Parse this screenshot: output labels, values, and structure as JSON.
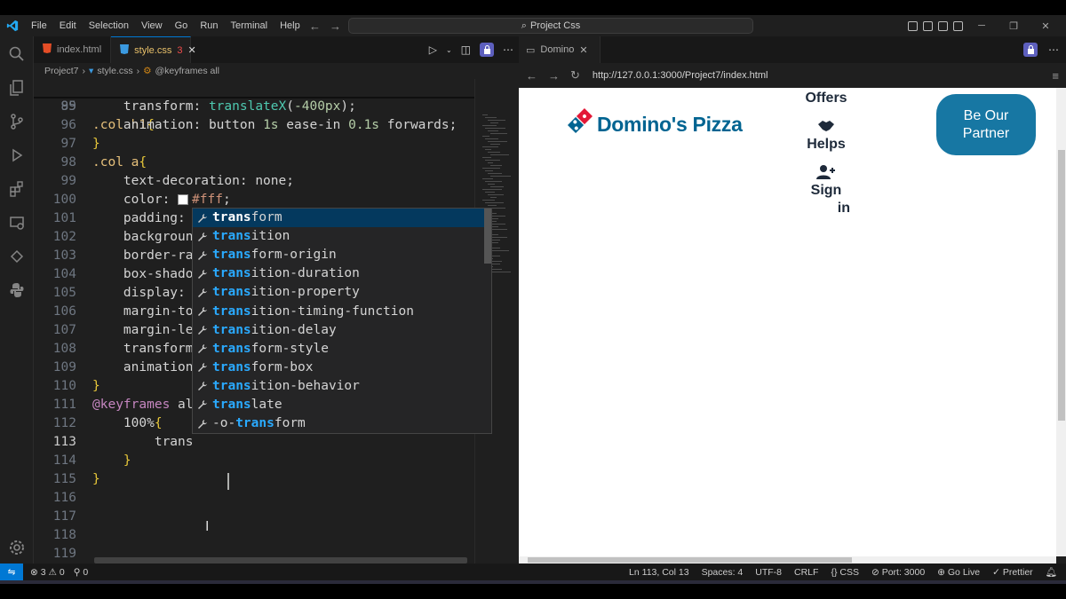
{
  "titlebar": {
    "menu": [
      "File",
      "Edit",
      "Selection",
      "View",
      "Go",
      "Run",
      "Terminal",
      "Help"
    ],
    "command_center": "Project Css"
  },
  "tabs": [
    {
      "label": "index.html",
      "icon": "html5-icon"
    },
    {
      "label": "style.css",
      "problems": "3",
      "icon": "css-icon"
    }
  ],
  "breadcrumb": {
    "folder": "Project7",
    "file": "style.css",
    "symbol": "@keyframes all"
  },
  "sticky_line": {
    "number": "89",
    "text": ".col h1{"
  },
  "code_lines": [
    {
      "n": "95",
      "t": "    transform: translateX(-400px);"
    },
    {
      "n": "96",
      "t": "    animation: button 1s ease-in 0.1s forwards;"
    },
    {
      "n": "97",
      "t": "}"
    },
    {
      "n": "98",
      "t": ".col a{"
    },
    {
      "n": "99",
      "t": "    text-decoration: none;"
    },
    {
      "n": "100",
      "t": "    color: #fff;"
    },
    {
      "n": "101",
      "t": "    padding:"
    },
    {
      "n": "102",
      "t": "    backgroun"
    },
    {
      "n": "103",
      "t": "    border-ra"
    },
    {
      "n": "104",
      "t": "    box-shado"
    },
    {
      "n": "105",
      "t": "    display:"
    },
    {
      "n": "106",
      "t": "    margin-to"
    },
    {
      "n": "107",
      "t": "    margin-le"
    },
    {
      "n": "108",
      "t": "    transform"
    },
    {
      "n": "109",
      "t": "    animation"
    },
    {
      "n": "110",
      "t": "}"
    },
    {
      "n": "111",
      "t": "@keyframes al"
    },
    {
      "n": "112",
      "t": "    100%{"
    },
    {
      "n": "113",
      "t": "        trans"
    },
    {
      "n": "114",
      "t": "    }"
    },
    {
      "n": "115",
      "t": "}"
    },
    {
      "n": "116",
      "t": ""
    },
    {
      "n": "117",
      "t": ""
    },
    {
      "n": "118",
      "t": ""
    },
    {
      "n": "119",
      "t": ""
    }
  ],
  "suggestions": [
    {
      "m": "trans",
      "r": "form"
    },
    {
      "m": "trans",
      "r": "ition"
    },
    {
      "m": "trans",
      "r": "form-origin"
    },
    {
      "m": "trans",
      "r": "ition-duration"
    },
    {
      "m": "trans",
      "r": "ition-property"
    },
    {
      "m": "trans",
      "r": "ition-timing-function"
    },
    {
      "m": "trans",
      "r": "ition-delay"
    },
    {
      "m": "trans",
      "r": "form-style"
    },
    {
      "m": "trans",
      "r": "form-box"
    },
    {
      "m": "trans",
      "r": "ition-behavior"
    },
    {
      "m": "trans",
      "r": "late"
    },
    {
      "p": "-o-",
      "m": "trans",
      "r": "form"
    }
  ],
  "browser": {
    "tab_title": "Domino",
    "url": "http://127.0.0.1:3000/Project7/index.html",
    "brand": "Domino's Pizza",
    "nav": {
      "offers": "Offers",
      "helps": "Helps",
      "signin_1": "Sign",
      "signin_2": "in"
    },
    "partner_1": "Be Our",
    "partner_2": "Partner"
  },
  "statusbar": {
    "errors": "3",
    "warnings": "0",
    "ports": "0",
    "position": "Ln 113, Col 13",
    "spaces": "Spaces: 4",
    "encoding": "UTF-8",
    "eol": "CRLF",
    "language": "CSS",
    "port": "Port: 3000",
    "golive": "Go Live",
    "prettier": "Prettier"
  },
  "colors": {
    "accent": "#0078d4",
    "brand": "#006491",
    "partner": "#1777a3",
    "domino_red": "#e31837"
  }
}
